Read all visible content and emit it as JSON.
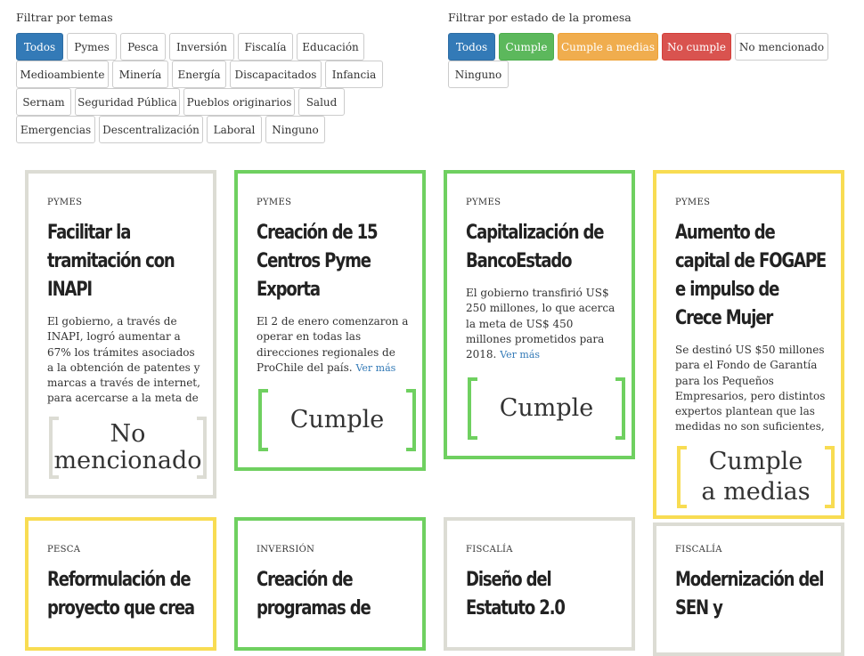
{
  "filters": {
    "topics": {
      "title": "Filtrar por temas",
      "buttons": [
        "Todos",
        "Pymes",
        "Pesca",
        "Inversión",
        "Fiscalía",
        "Educación",
        "Medioambiente",
        "Minería",
        "Energía",
        "Discapacitados",
        "Infancia",
        "Sernam",
        "Seguridad Pública",
        "Pueblos originarios",
        "Salud",
        "Emergencias",
        "Descentralización",
        "Laboral",
        "Ninguno"
      ]
    },
    "status": {
      "title": "Filtrar por estado de la promesa",
      "buttons": [
        "Todos",
        "Cumple",
        "Cumple a medias",
        "No cumple",
        "No mencionado",
        "Ninguno"
      ]
    }
  },
  "colors": {
    "primary": "#337ab7",
    "cumple": "#5cb85c",
    "medias": "#f0ad4e",
    "nocumple": "#d9534f",
    "neutral": "#dcdcd4",
    "card_green": "#6fd060",
    "card_yellow": "#f8dc52"
  },
  "cards": [
    {
      "category": "PYMES",
      "title": "Facilitar la tramitación con INAPI",
      "text": "El gobierno, a través de INAPI, logró aumentar a 67% los trámites asociados a la obtención de patentes y marcas a través de internet, para acercarse a la meta de",
      "more": "",
      "stamp_line1": "No",
      "stamp_line2": "mencionado"
    },
    {
      "category": "PYMES",
      "title": "Creación de 15 Centros Pyme Exporta",
      "text": "El 2 de enero comenzaron a operar en todas las direcciones regionales de ProChile del país.",
      "more": "Ver más",
      "stamp_line1": "Cumple",
      "stamp_line2": ""
    },
    {
      "category": "PYMES",
      "title": "Capitalización de BancoEstado",
      "text": "El gobierno transfirió US$ 250 millones, lo que acerca la meta de US$ 450 millones prometidos para 2018.",
      "more": "Ver más",
      "stamp_line1": "Cumple",
      "stamp_line2": ""
    },
    {
      "category": "PYMES",
      "title": "Aumento de capital de FOGAPE e impulso de Crece Mujer",
      "text": "Se destinó US $50 millones para el Fondo de Garantía para los Pequeños Empresarios, pero distintos expertos plantean que las medidas no son suficientes,",
      "more": "",
      "stamp_line1": "Cumple",
      "stamp_line2": "a medias"
    },
    {
      "category": "PESCA",
      "title": "Reformulación de proyecto que crea",
      "text": "",
      "more": "",
      "stamp_line1": "",
      "stamp_line2": ""
    },
    {
      "category": "INVERSIÓN",
      "title": "Creación de programas de",
      "text": "",
      "more": "",
      "stamp_line1": "",
      "stamp_line2": ""
    },
    {
      "category": "FISCALÍA",
      "title": "Diseño del Estatuto 2.0",
      "text": "",
      "more": "",
      "stamp_line1": "",
      "stamp_line2": ""
    },
    {
      "category": "FISCALÍA",
      "title": "Modernización del SEN y",
      "text": "",
      "more": "",
      "stamp_line1": "",
      "stamp_line2": ""
    }
  ]
}
